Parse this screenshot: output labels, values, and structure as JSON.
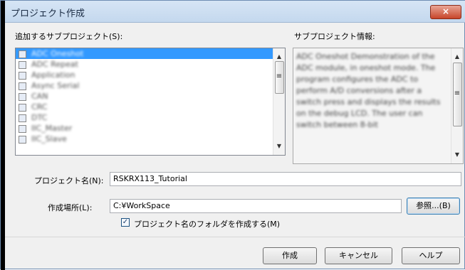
{
  "window": {
    "title": "プロジェクト作成",
    "close_glyph": "×"
  },
  "subprojects": {
    "label": "追加するサブプロジェクト(S):",
    "items": [
      "ADC Oneshot",
      "ADC Repeat",
      "Application",
      "Async Serial",
      "CAN",
      "CRC",
      "DTC",
      "IIC_Master",
      "IIC_Slave"
    ],
    "selected_index": 0
  },
  "info": {
    "label": "サブプロジェクト情報:",
    "text": "ADC Oneshot  Demonstration of the ADC module, in oneshot mode. The program configures the ADC to perform A/D conversions after a switch press and displays the results on the debug LCD. The user can switch between 8-bit"
  },
  "project_name": {
    "label": "プロジェクト名(N):",
    "value": "RSKRX113_Tutorial"
  },
  "location": {
    "label": "作成場所(L):",
    "value": "C:¥WorkSpace",
    "browse_label": "参照...(B)"
  },
  "create_folder": {
    "label": "プロジェクト名のフォルダを作成する(M)",
    "checked": true,
    "check_glyph": "✓"
  },
  "buttons": {
    "create": "作成",
    "cancel": "キャンセル",
    "help": "ヘルプ"
  },
  "scroll": {
    "up": "▲",
    "down": "▼",
    "grip": "≡"
  }
}
